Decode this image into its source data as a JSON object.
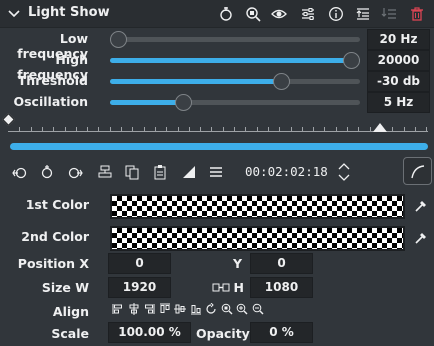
{
  "panel": {
    "title": "Light Show",
    "header_icons": [
      "reset-icon",
      "compare-icon",
      "visibility-icon",
      "presets-icon",
      "info-icon",
      "collapse-keyframes-icon",
      "save-icon",
      "delete-icon"
    ]
  },
  "params": [
    {
      "label": "Low frequency",
      "value": "20 Hz",
      "fraction": 0.0
    },
    {
      "label": "High frequency",
      "value": "20000 Hz",
      "fraction": 1.0
    },
    {
      "label": "Threshold",
      "value": "-30 db",
      "fraction": 0.7
    },
    {
      "label": "Oscillation",
      "value": "5 Hz",
      "fraction": 0.28
    }
  ],
  "keyframes": {
    "playhead_fraction": 0.885,
    "keyframe_fraction": 0.0
  },
  "toolbar": {
    "timecode": "00:02:02:18",
    "icons": [
      "previous-keyframe-icon",
      "add-keyframe-icon",
      "next-keyframe-icon",
      "align-icon",
      "copy-icon",
      "paste-icon",
      "interpolation-icon",
      "menu-icon"
    ]
  },
  "colors": [
    {
      "label": "1st Color"
    },
    {
      "label": "2nd Color"
    }
  ],
  "geometry": {
    "position_x_label": "Position X",
    "position_x": "0",
    "y_label": "Y",
    "y": "0",
    "size_w_label": "Size W",
    "w": "1920",
    "h_label": "H",
    "h": "1080",
    "align_label": "Align",
    "scale_label": "Scale",
    "scale": "100.00 %",
    "opacity_label": "Opacity",
    "opacity": "0 %"
  }
}
